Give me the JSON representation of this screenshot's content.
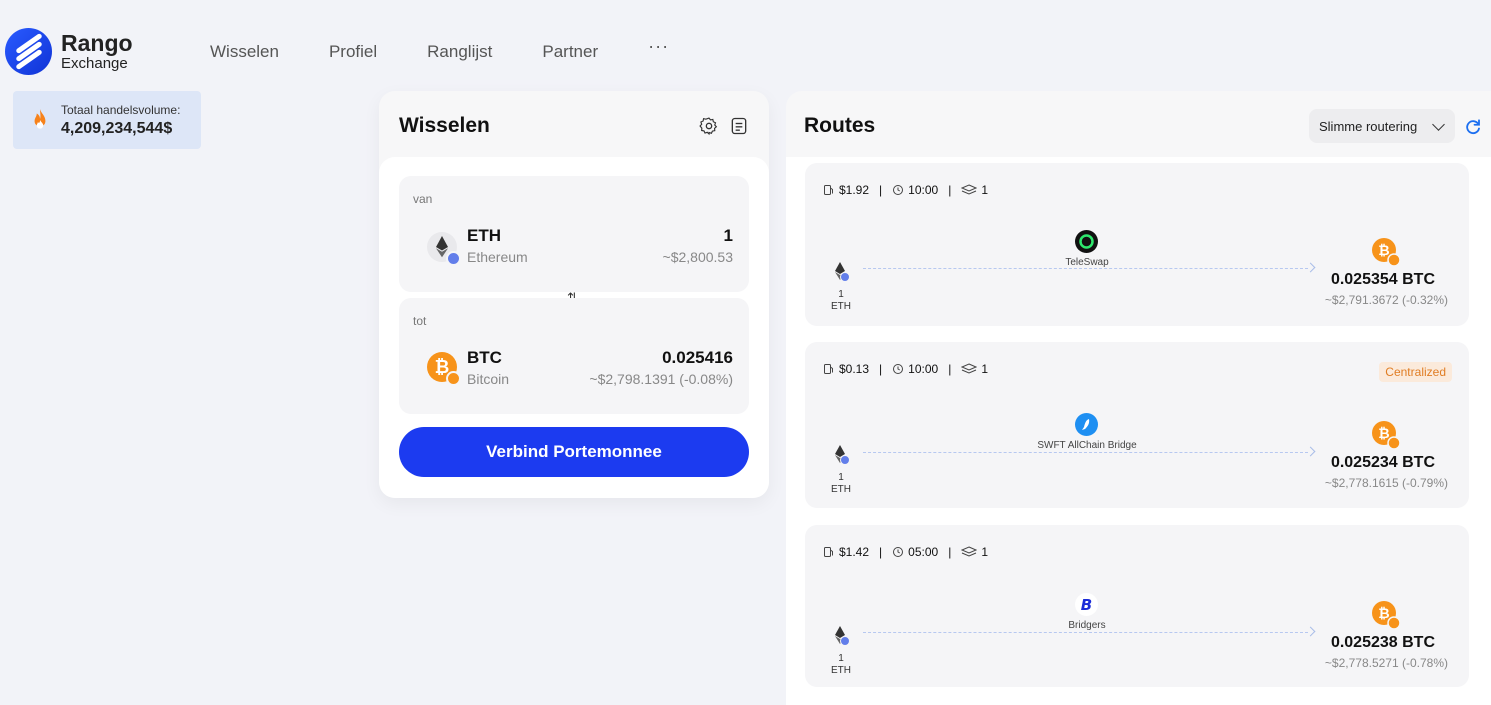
{
  "brand": {
    "name": "Rango",
    "sub": "Exchange"
  },
  "nav": {
    "items": [
      "Wisselen",
      "Profiel",
      "Ranglijst",
      "Partner"
    ],
    "more": "···"
  },
  "volume": {
    "label": "Totaal handelsvolume:",
    "value": "4,209,234,544$"
  },
  "swap": {
    "title": "Wisselen",
    "from": {
      "label": "van",
      "symbol": "ETH",
      "name": "Ethereum",
      "amount": "1",
      "usd": "~$2,800.53"
    },
    "to": {
      "label": "tot",
      "symbol": "BTC",
      "name": "Bitcoin",
      "amount": "0.025416",
      "usd": "~$2,798.1391 (-0.08%)"
    },
    "switch": "⇅",
    "connect": "Verbind Portemonnee"
  },
  "routes": {
    "title": "Routes",
    "sort": "Slimme routering",
    "items": [
      {
        "fee": "$1.92",
        "time": "10:00",
        "steps": "1",
        "tag": "",
        "provider": "TeleSwap",
        "src_amount": "1",
        "src_symbol": "ETH",
        "amount": "0.025354 BTC",
        "usd": "~$2,791.3672  (-0.32%)"
      },
      {
        "fee": "$0.13",
        "time": "10:00",
        "steps": "1",
        "tag": "Centralized",
        "provider": "SWFT AllChain Bridge",
        "src_amount": "1",
        "src_symbol": "ETH",
        "amount": "0.025234 BTC",
        "usd": "~$2,778.1615  (-0.79%)"
      },
      {
        "fee": "$1.42",
        "time": "05:00",
        "steps": "1",
        "tag": "",
        "provider": "Bridgers",
        "src_amount": "1",
        "src_symbol": "ETH",
        "amount": "0.025238 BTC",
        "usd": "~$2,778.5271  (-0.78%)"
      }
    ]
  },
  "colors": {
    "accent": "#1c3bf0",
    "btc": "#f7931a",
    "eth_badge": "#627eea",
    "tag": "#e07d24"
  }
}
